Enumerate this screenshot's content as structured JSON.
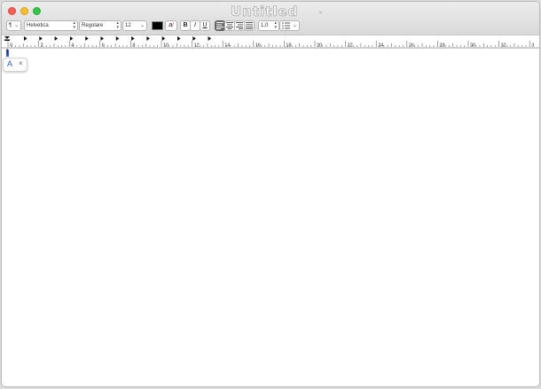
{
  "window": {
    "title": "Untitled"
  },
  "toolbar": {
    "paragraph_style_icon": "¶",
    "font_family": "Helvetica",
    "font_style": "Regolare",
    "font_size": "12",
    "text_color": "#000000",
    "bold": "B",
    "italic": "I",
    "underline": "U",
    "line_spacing": "1,0",
    "list_icon": "list-bullets-icon"
  },
  "ruler": {
    "labels": [
      "0",
      "2",
      "4",
      "6",
      "8",
      "10",
      "12",
      "14",
      "16",
      "18",
      "20",
      "22",
      "24",
      "26",
      "28",
      "30",
      "32",
      "3"
    ]
  },
  "editor": {
    "cursor_char": "I"
  },
  "popover": {
    "letter": "A",
    "close": "×"
  }
}
